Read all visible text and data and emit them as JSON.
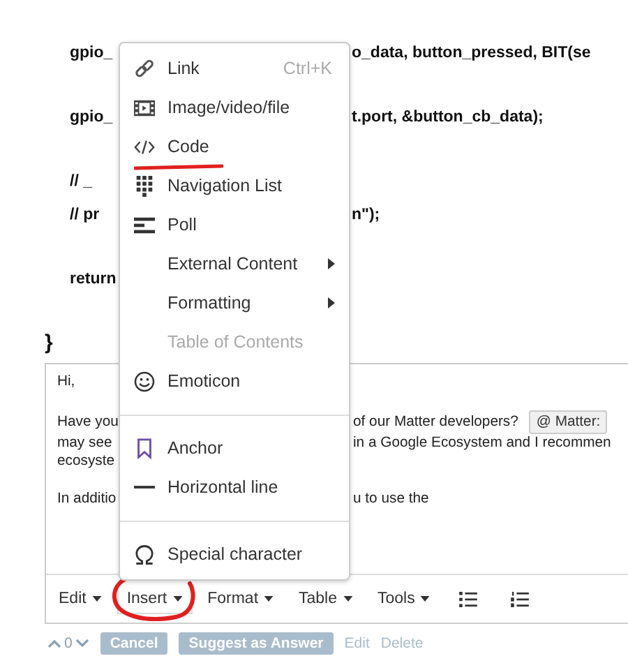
{
  "code": {
    "blocks": [
      {
        "lines": [
          {
            "left": "gpio_",
            "right": "o_data, button_pressed, BIT(se"
          }
        ]
      },
      {
        "lines": [
          {
            "left": "gpio_",
            "right": "t.port, &button_cb_data);"
          }
        ]
      },
      {
        "lines": [
          {
            "left": "//  _"
          },
          {
            "left": "//  pr",
            "right": "n\");"
          }
        ]
      },
      {
        "lines": [
          {
            "left": "return"
          }
        ]
      }
    ],
    "closing_brace": "}"
  },
  "editor": {
    "paragraphs": [
      {
        "lines": [
          {
            "left": "Hi,"
          }
        ]
      },
      {
        "lines": [
          {
            "left": "Have you",
            "right": "of our Matter developers?",
            "mention": "@ Matter:"
          },
          {
            "left": "may see",
            "right": "in a Google Ecosystem and I recommen"
          },
          {
            "left": "ecosyste"
          }
        ]
      },
      {
        "lines": [
          {
            "left": "In additio",
            "right": "u to use the"
          }
        ]
      }
    ],
    "toolbar": [
      {
        "label": "Edit",
        "open": false
      },
      {
        "label": "Insert",
        "open": true
      },
      {
        "label": "Format",
        "open": false
      },
      {
        "label": "Table",
        "open": false
      },
      {
        "label": "Tools",
        "open": false
      }
    ]
  },
  "insert_menu": {
    "items": [
      {
        "kind": "item",
        "label": "Link",
        "shortcut": "Ctrl+K",
        "submenu": false,
        "disabled": false
      },
      {
        "kind": "item",
        "label": "Image/video/file",
        "submenu": false,
        "disabled": false
      },
      {
        "kind": "item",
        "label": "Code",
        "submenu": false,
        "disabled": false
      },
      {
        "kind": "item",
        "label": "Navigation List",
        "submenu": false,
        "disabled": false
      },
      {
        "kind": "item",
        "label": "Poll",
        "submenu": false,
        "disabled": false
      },
      {
        "kind": "item",
        "label": "External Content",
        "submenu": true,
        "disabled": false
      },
      {
        "kind": "item",
        "label": "Formatting",
        "submenu": true,
        "disabled": false
      },
      {
        "kind": "item",
        "label": "Table of Contents",
        "submenu": false,
        "disabled": true
      },
      {
        "kind": "item",
        "label": "Emoticon",
        "submenu": false,
        "disabled": false
      },
      {
        "kind": "divider"
      },
      {
        "kind": "item",
        "label": "Anchor",
        "submenu": false,
        "disabled": false
      },
      {
        "kind": "item",
        "label": "Horizontal line",
        "submenu": false,
        "disabled": false
      },
      {
        "kind": "divider"
      },
      {
        "kind": "item",
        "label": "Special character",
        "submenu": false,
        "disabled": false
      }
    ]
  },
  "footer": {
    "votes": "0",
    "buttons": [
      "Cancel",
      "Suggest as Answer"
    ],
    "links": [
      "Edit",
      "Delete"
    ]
  }
}
